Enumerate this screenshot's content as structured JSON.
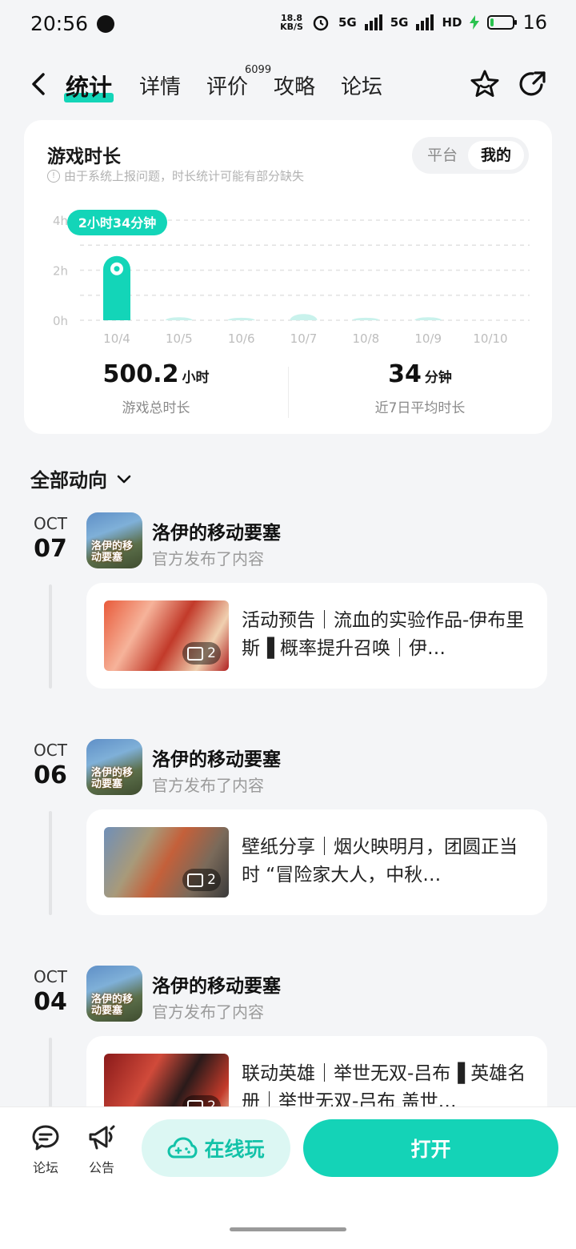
{
  "status_bar": {
    "time": "20:56",
    "net_speed": "18.8",
    "net_unit": "KB/S",
    "signal1": "5G",
    "signal2": "5G",
    "hd": "HD",
    "battery": "16"
  },
  "nav": {
    "tabs": [
      {
        "label": "统计",
        "active": true
      },
      {
        "label": "详情"
      },
      {
        "label": "评价",
        "badge": "6099"
      },
      {
        "label": "攻略"
      },
      {
        "label": "论坛"
      }
    ]
  },
  "stats": {
    "title": "游戏时长",
    "note": "由于系统上报问题，时长统计可能有部分缺失",
    "toggle": {
      "platform": "平台",
      "mine": "我的",
      "selected": "我的"
    },
    "total_value": "500.2",
    "total_unit": "小时",
    "total_label": "游戏总时长",
    "avg_value": "34",
    "avg_unit": "分钟",
    "avg_label": "近7日平均时长"
  },
  "chart_data": {
    "type": "bar",
    "title": "",
    "categories": [
      "10/4",
      "10/5",
      "10/6",
      "10/7",
      "10/8",
      "10/9",
      "10/10"
    ],
    "values": [
      2.57,
      0.12,
      0.1,
      0.25,
      0.1,
      0.12,
      0
    ],
    "unit": "h",
    "yticks": [
      "0h",
      "2h",
      "4h"
    ],
    "ylim": [
      0,
      4
    ],
    "highlight": {
      "index": 0,
      "label": "2小时34分钟"
    },
    "grid": true,
    "colors": {
      "bar_selected": "#13d5b8",
      "bar": "#c9f2ec"
    }
  },
  "feed": {
    "header": "全部动向",
    "entries": [
      {
        "month": "OCT",
        "day": "07",
        "game": "洛伊的移动要塞",
        "action": "官方发布了内容",
        "post_text": "活动预告｜流血的实验作品-伊布里斯▐ 概率提升召唤｜伊…",
        "images": "2"
      },
      {
        "month": "OCT",
        "day": "06",
        "game": "洛伊的移动要塞",
        "action": "官方发布了内容",
        "post_text": "壁纸分享｜烟火映明月，团圆正当时 “冒险家大人，中秋…",
        "images": "2"
      },
      {
        "month": "OCT",
        "day": "04",
        "game": "洛伊的移动要塞",
        "action": "官方发布了内容",
        "post_text": "联动英雄｜举世无双-吕布▐ 英雄名册｜举世无双-吕布 盖世…",
        "images": "2"
      }
    ],
    "icon_text": "洛伊的移动要塞"
  },
  "bottom_bar": {
    "forum": "论坛",
    "notice": "公告",
    "play_online": "在线玩",
    "open": "打开"
  }
}
